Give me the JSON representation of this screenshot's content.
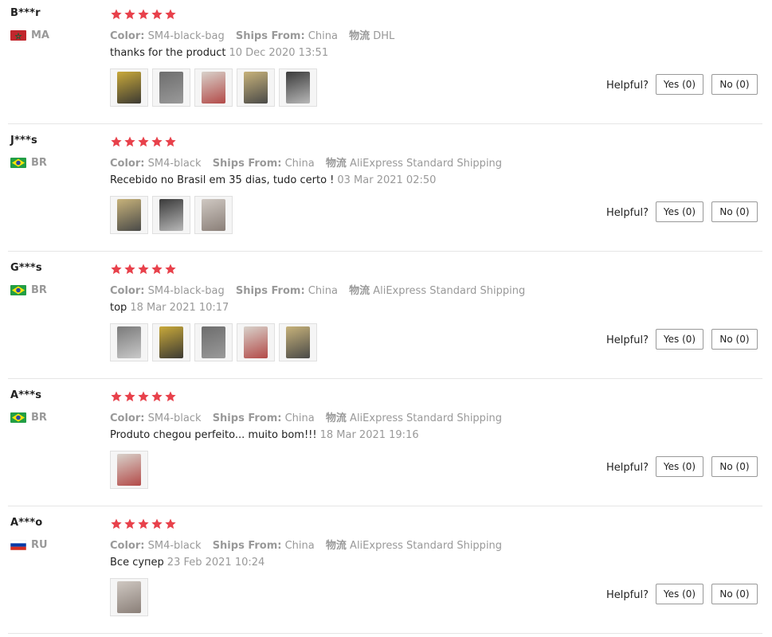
{
  "labels": {
    "color": "Color:",
    "ships_from": "Ships From:",
    "logistics": "物流",
    "helpful": "Helpful?"
  },
  "rating_stars": 5,
  "star_color": "#e8414b",
  "reviews": [
    {
      "user": "B***r",
      "country": "MA",
      "flag": "morocco-flag-icon",
      "rating": 5,
      "color": "SM4-black-bag",
      "ships_from": "China",
      "logistics": "DHL",
      "text": "thanks for the product",
      "date": "10 Dec 2020 13:51",
      "photo_count": 5,
      "yes": "Yes (0)",
      "no": "No (0)"
    },
    {
      "user": "J***s",
      "country": "BR",
      "flag": "brazil-flag-icon",
      "rating": 5,
      "color": "SM4-black",
      "ships_from": "China",
      "logistics": "AliExpress Standard Shipping",
      "text": "Recebido no Brasil em 35 dias, tudo certo !",
      "date": "03 Mar 2021 02:50",
      "photo_count": 3,
      "yes": "Yes (0)",
      "no": "No (0)"
    },
    {
      "user": "G***s",
      "country": "BR",
      "flag": "brazil-flag-icon",
      "rating": 5,
      "color": "SM4-black-bag",
      "ships_from": "China",
      "logistics": "AliExpress Standard Shipping",
      "text": "top",
      "date": "18 Mar 2021 10:17",
      "photo_count": 5,
      "yes": "Yes (0)",
      "no": "No (0)"
    },
    {
      "user": "A***s",
      "country": "BR",
      "flag": "brazil-flag-icon",
      "rating": 5,
      "color": "SM4-black",
      "ships_from": "China",
      "logistics": "AliExpress Standard Shipping",
      "text": "Produto chegou perfeito... muito bom!!!",
      "date": "18 Mar 2021 19:16",
      "photo_count": 1,
      "yes": "Yes (0)",
      "no": "No (0)"
    },
    {
      "user": "A***o",
      "country": "RU",
      "flag": "russia-flag-icon",
      "rating": 5,
      "color": "SM4-black",
      "ships_from": "China",
      "logistics": "AliExpress Standard Shipping",
      "text": "Все супер",
      "date": "23 Feb 2021 10:24",
      "photo_count": 1,
      "yes": "Yes (0)",
      "no": "No (0)"
    }
  ]
}
